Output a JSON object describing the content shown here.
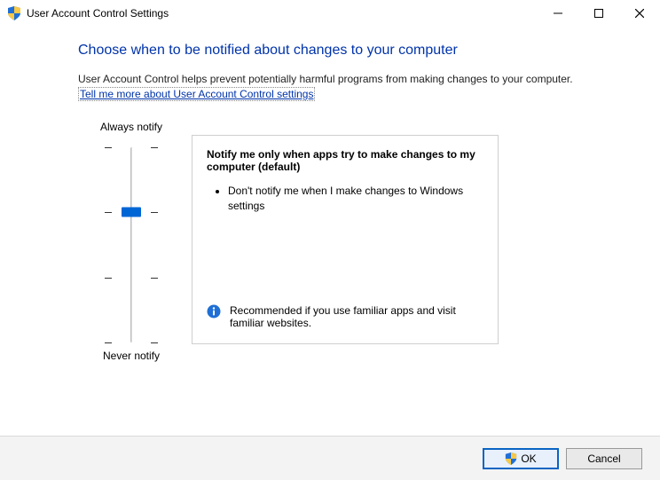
{
  "window": {
    "title": "User Account Control Settings"
  },
  "main": {
    "heading": "Choose when to be notified about changes to your computer",
    "description": "User Account Control helps prevent potentially harmful programs from making changes to your computer.",
    "link": "Tell me more about User Account Control settings"
  },
  "slider": {
    "top_label": "Always notify",
    "bottom_label": "Never notify",
    "levels": 4,
    "current_level": 2
  },
  "panel": {
    "title": "Notify me only when apps try to make changes to my computer (default)",
    "bullet1": "Don't notify me when I make changes to Windows settings",
    "recommend": "Recommended if you use familiar apps and visit familiar websites."
  },
  "footer": {
    "ok": "OK",
    "cancel": "Cancel"
  }
}
